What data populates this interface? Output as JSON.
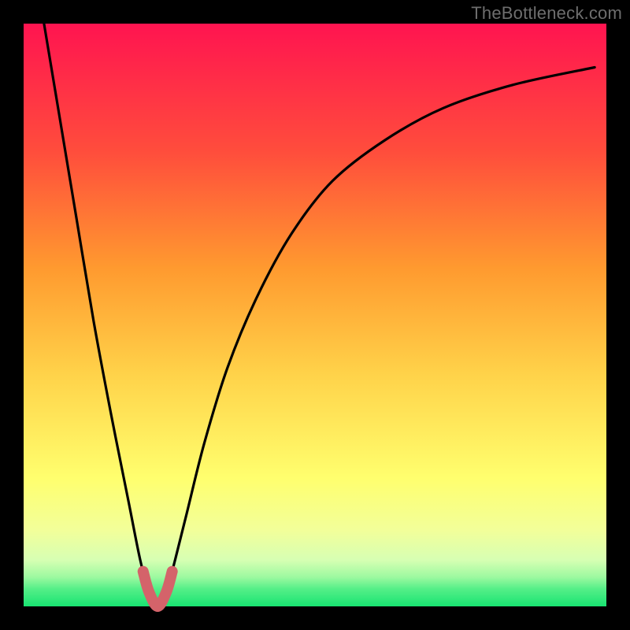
{
  "watermark": "TheBottleneck.com",
  "colors": {
    "page_bg": "#000000",
    "gradient_top": "#ff1450",
    "gradient_mid_upper": "#ff7d2f",
    "gradient_mid": "#ffd249",
    "gradient_lower": "#ffff6e",
    "gradient_pale": "#f6ffb1",
    "gradient_bottom": "#18e472",
    "curve": "#000000",
    "highlight": "#d4636a"
  },
  "chart_data": {
    "type": "line",
    "title": "",
    "xlabel": "",
    "ylabel": "",
    "xlim": [
      0,
      100
    ],
    "ylim": [
      0,
      100
    ],
    "optimal_x": 23,
    "series": [
      {
        "name": "bottleneck-curve",
        "color": "#000000",
        "x": [
          3.5,
          6,
          9,
          12,
          15,
          18,
          20,
          21.5,
          23,
          24.5,
          26,
          28,
          31,
          35,
          40,
          46,
          53,
          62,
          72,
          84,
          98
        ],
        "y": [
          100,
          85,
          67,
          49,
          33,
          18,
          8,
          2.5,
          0,
          2.5,
          8,
          16,
          28,
          41,
          53,
          64,
          73,
          80,
          85.5,
          89.5,
          92.5
        ]
      }
    ],
    "highlight_segment": {
      "name": "optimal-zone",
      "color": "#d4636a",
      "x": [
        20.5,
        21.5,
        23,
        24.5,
        25.5
      ],
      "y": [
        6,
        2.5,
        0,
        2.5,
        6
      ]
    }
  }
}
